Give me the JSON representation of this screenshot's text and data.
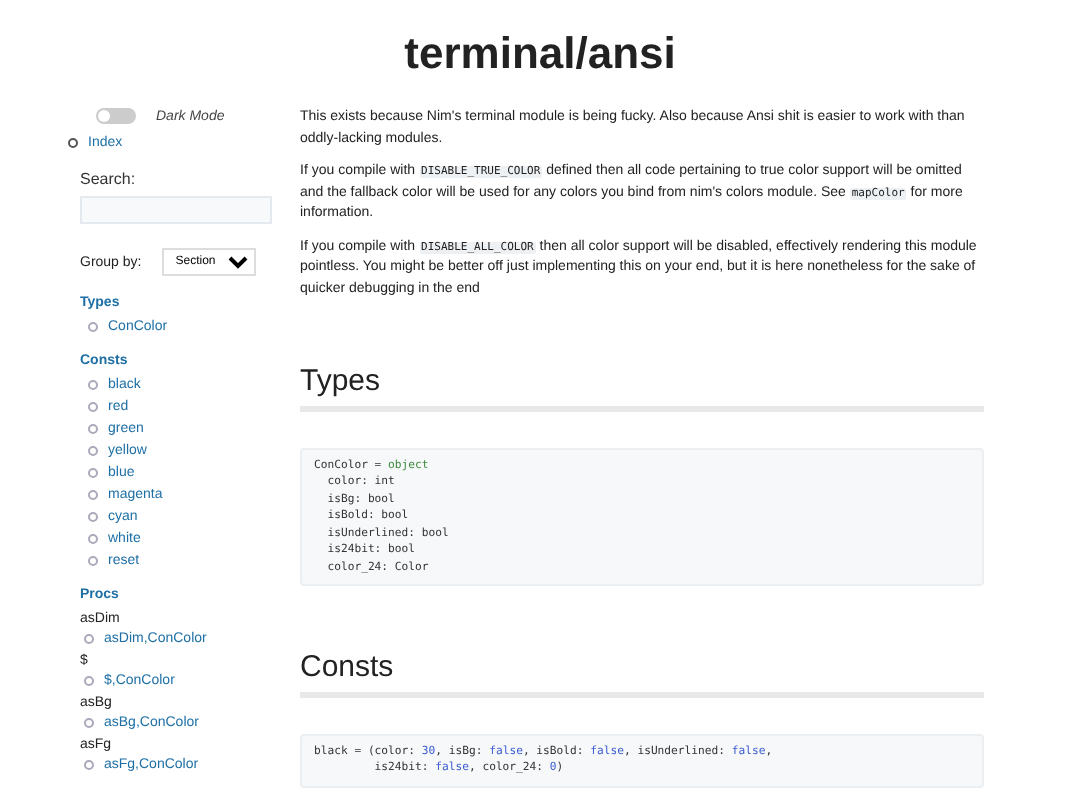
{
  "title": "terminal/ansi",
  "sidebar": {
    "dark_mode": {
      "label": "Dark Mode",
      "on": false
    },
    "index_link": "Index",
    "search": {
      "label": "Search:"
    },
    "group_by": {
      "label": "Group by:",
      "value": "Section"
    },
    "sections": [
      {
        "title": "Types",
        "items": [
          "ConColor"
        ]
      },
      {
        "title": "Consts",
        "items": [
          "black",
          "red",
          "green",
          "yellow",
          "blue",
          "magenta",
          "cyan",
          "white",
          "reset"
        ]
      },
      {
        "title": "Procs",
        "groups": [
          {
            "name": "asDim",
            "items": [
              "asDim,ConColor"
            ]
          },
          {
            "name": "$",
            "items": [
              "$,ConColor"
            ]
          },
          {
            "name": "asBg",
            "items": [
              "asBg,ConColor"
            ]
          },
          {
            "name": "asFg",
            "items": [
              "asFg,ConColor"
            ]
          }
        ]
      }
    ]
  },
  "intro": [
    [
      {
        "kind": "text",
        "text": "This exists because Nim's terminal module is being fucky. Also because Ansi shit is easier to work with than oddly-lacking modules."
      }
    ],
    [
      {
        "kind": "text",
        "text": "If you compile with "
      },
      {
        "kind": "code",
        "text": "DISABLE_TRUE_COLOR"
      },
      {
        "kind": "text",
        "text": " defined then all code pertaining to true color support will be omitted and the fallback color will be used for any colors you bind from nim's colors module. See "
      },
      {
        "kind": "code",
        "text": "mapColor"
      },
      {
        "kind": "text",
        "text": " for more information."
      }
    ],
    [
      {
        "kind": "text",
        "text": "If you compile with "
      },
      {
        "kind": "code",
        "text": "DISABLE_ALL_COLOR"
      },
      {
        "kind": "text",
        "text": " then all color support will be disabled, effectively rendering this module pointless. You might be better off just implementing this on your end, but it is here nonetheless for the sake of quicker debugging in the end"
      }
    ]
  ],
  "sections": [
    {
      "heading": "Types",
      "code": [
        [
          {
            "kind": "plain",
            "text": "ConColor = "
          },
          {
            "kind": "keyword",
            "text": "object"
          }
        ],
        [
          {
            "kind": "plain",
            "text": "  color: int"
          }
        ],
        [
          {
            "kind": "plain",
            "text": "  isBg: bool"
          }
        ],
        [
          {
            "kind": "plain",
            "text": "  isBold: bool"
          }
        ],
        [
          {
            "kind": "plain",
            "text": "  isUnderlined: bool"
          }
        ],
        [
          {
            "kind": "plain",
            "text": "  is24bit: bool"
          }
        ],
        [
          {
            "kind": "plain",
            "text": "  color_24: Color"
          }
        ]
      ]
    },
    {
      "heading": "Consts",
      "code": [
        [
          {
            "kind": "plain",
            "text": "black = (color: "
          },
          {
            "kind": "value",
            "text": "30"
          },
          {
            "kind": "plain",
            "text": ", isBg: "
          },
          {
            "kind": "value",
            "text": "false"
          },
          {
            "kind": "plain",
            "text": ", isBold: "
          },
          {
            "kind": "value",
            "text": "false"
          },
          {
            "kind": "plain",
            "text": ", isUnderlined: "
          },
          {
            "kind": "value",
            "text": "false"
          },
          {
            "kind": "plain",
            "text": ","
          }
        ],
        [
          {
            "kind": "plain",
            "text": "         is24bit: "
          },
          {
            "kind": "value",
            "text": "false"
          },
          {
            "kind": "plain",
            "text": ", color_24: "
          },
          {
            "kind": "value",
            "text": "0"
          },
          {
            "kind": "plain",
            "text": ")"
          }
        ]
      ]
    }
  ]
}
